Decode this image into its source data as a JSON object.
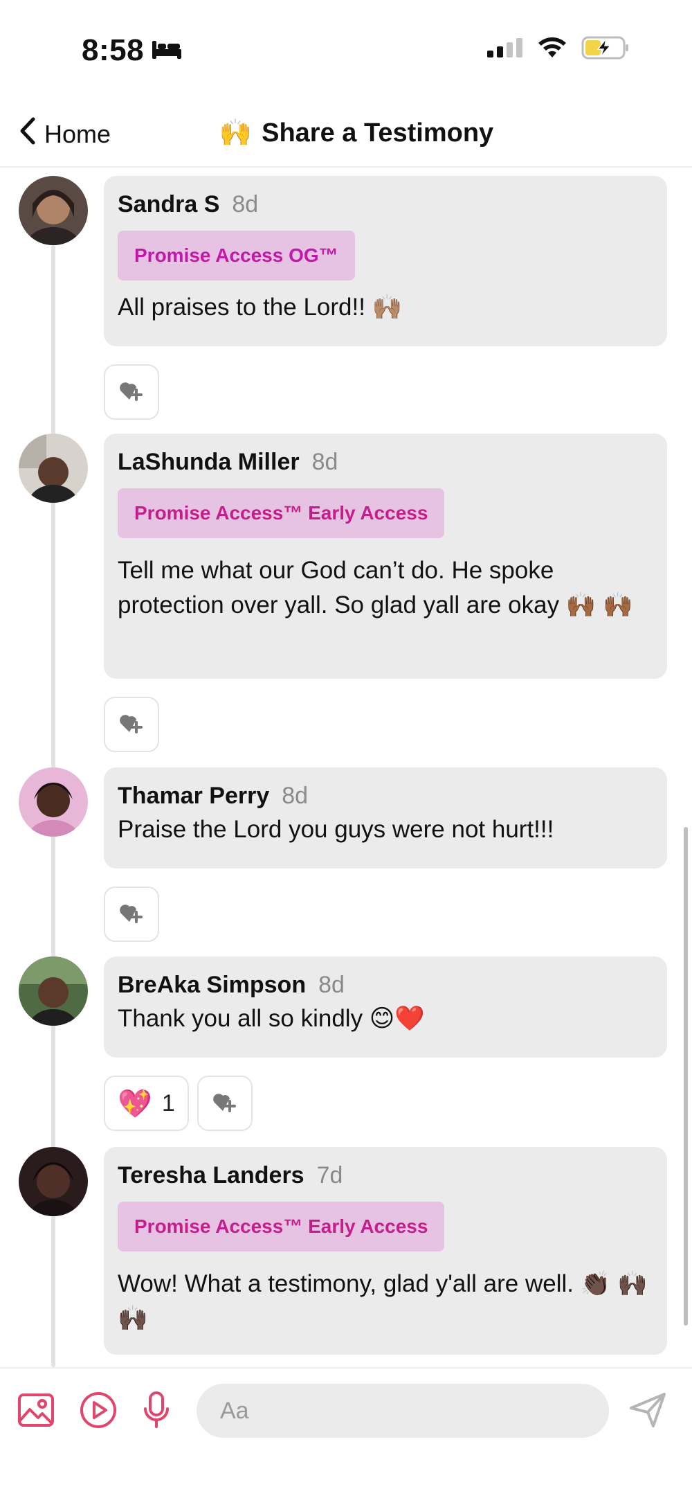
{
  "status_bar": {
    "time": "8:58"
  },
  "header": {
    "back_label": "Home",
    "title": "Share a Testimony",
    "title_emoji": "🙌"
  },
  "comments": [
    {
      "name": "Sandra S",
      "age": "8d",
      "badge": "Promise Access OG™",
      "text": "All praises to the Lord!! 🙌🏽",
      "avatar_color": "#a77c63"
    },
    {
      "name": "LaShunda Miller",
      "age": "8d",
      "badge": "Promise Access™ Early Access",
      "text": "Tell me what our God can’t do. He spoke protection over yall. So glad yall are okay 🙌🏾 🙌🏾",
      "avatar_color": "#6b4a3a"
    },
    {
      "name": "Thamar Perry",
      "age": "8d",
      "badge": "",
      "text": "Praise the Lord you guys were not hurt!!!",
      "avatar_color": "#8a4f6e"
    },
    {
      "name": "BreAka Simpson",
      "age": "8d",
      "badge": "",
      "text": "Thank you all so kindly 😊❤️",
      "avatar_color": "#5b4034",
      "reaction": {
        "emoji": "💖",
        "count": "1"
      }
    },
    {
      "name": "Teresha Landers",
      "age": "7d",
      "badge": "Promise Access™ Early Access",
      "text": "Wow! What a testimony, glad y'all are well. 👏🏿 🙌🏿🙌🏿",
      "avatar_color": "#3e2a2a"
    }
  ],
  "composer": {
    "placeholder": "Aa"
  },
  "colors": {
    "accent": "#e0466c",
    "badge_bg": "#e6c3e3",
    "badge_text": "#c218a7",
    "bubble_bg": "#ebebeb"
  }
}
